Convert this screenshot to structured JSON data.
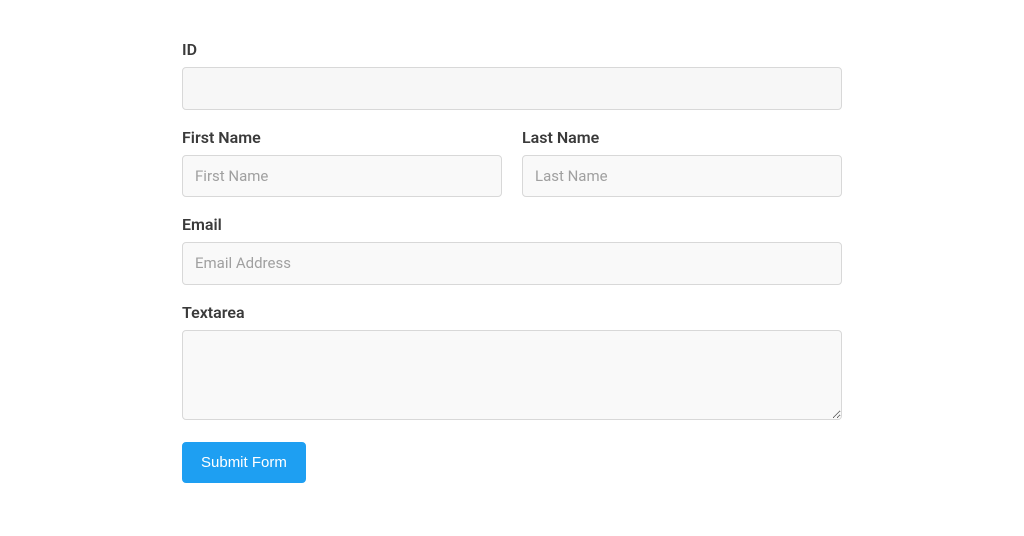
{
  "form": {
    "id": {
      "label": "ID",
      "value": ""
    },
    "first_name": {
      "label": "First Name",
      "placeholder": "First Name",
      "value": ""
    },
    "last_name": {
      "label": "Last Name",
      "placeholder": "Last Name",
      "value": ""
    },
    "email": {
      "label": "Email",
      "placeholder": "Email Address",
      "value": ""
    },
    "textarea": {
      "label": "Textarea",
      "value": ""
    },
    "submit_label": "Submit Form"
  }
}
